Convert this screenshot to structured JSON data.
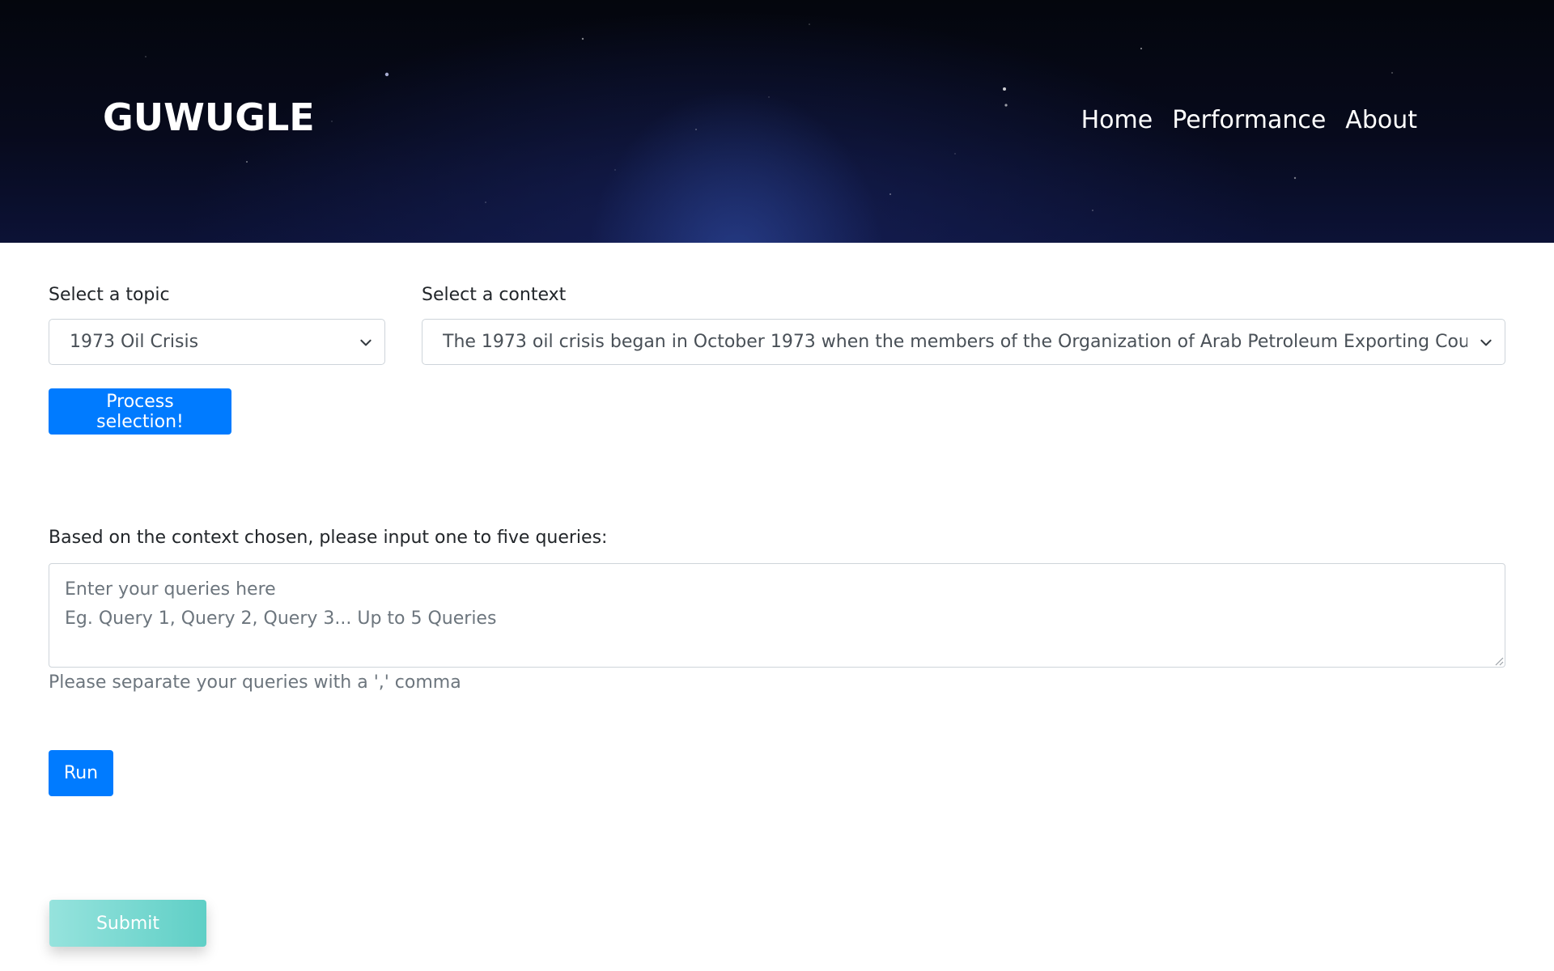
{
  "header": {
    "brand": "GUWUGLE",
    "nav": [
      {
        "label": "Home"
      },
      {
        "label": "Performance"
      },
      {
        "label": "About"
      }
    ]
  },
  "form": {
    "topic": {
      "label": "Select a topic",
      "selected": "1973 Oil Crisis"
    },
    "context": {
      "label": "Select a context",
      "selected": "The 1973 oil crisis began in October 1973 when the members of the Organization of Arab Petroleum Exporting Countries"
    },
    "process_button": "Process selection!",
    "queries": {
      "label": "Based on the context chosen, please input one to five queries:",
      "placeholder": "Enter your queries here\nEg. Query 1, Query 2, Query 3... Up to 5 Queries",
      "help": "Please separate your queries with a ',' comma"
    },
    "run_button": "Run",
    "submit_button": "Submit"
  },
  "colors": {
    "primary": "#007bff",
    "submit_gradient_start": "#96e3dd",
    "submit_gradient_end": "#5fcfc6",
    "hero_dark": "#04060d"
  }
}
